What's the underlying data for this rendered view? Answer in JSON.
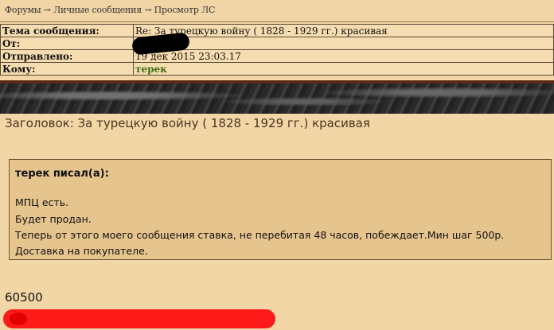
{
  "header": {
    "breadcrumb": "Форумы → Личные сообщения → Просмотр ЛС"
  },
  "message_meta": {
    "subject_label": "Тема сообщения:",
    "subject_value": "Re: За турецкую войну ( 1828 - 1929 гг.) красивая",
    "from_label": "От:",
    "from_value": "",
    "sent_label": "Отправлено:",
    "sent_value": "19 дек 2015 23:03.17",
    "to_label": "Кому:",
    "to_value": "терек"
  },
  "body": {
    "title": "Заголовок: За турецкую войну ( 1828 - 1929 гг.) красивая",
    "quote_author": "терек писал(а):",
    "quote_lines": [
      "МПЦ есть.",
      "Будет продан.",
      "Теперь от этого моего сообщения ставка, не перебитая 48 часов, побеждает.Мин шаг 500р.",
      "Доставка на покупателе."
    ],
    "bid": "60500"
  },
  "colors": {
    "background": "#f3d6a6",
    "quote_bg": "#e6c48d",
    "recipient": "#3b6b12",
    "redaction_red": "#ff1a1a"
  }
}
